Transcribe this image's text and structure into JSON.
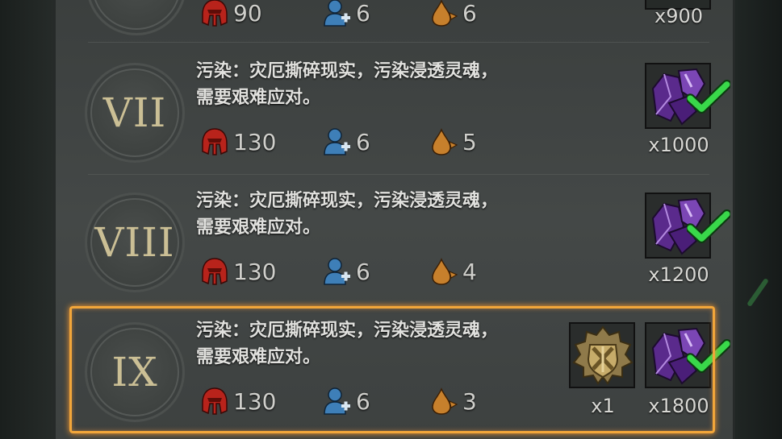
{
  "colors": {
    "highlight": "#f2a63a",
    "numeral": "#cbbf95",
    "helmet": "#b8231b",
    "player": "#3e7fb8",
    "drop": "#c7802c",
    "check": "#39d84a"
  },
  "top_row": {
    "attack": "90",
    "players": "6",
    "drops": "6",
    "reward_qty": "x900"
  },
  "levels": [
    {
      "numeral": "VII",
      "desc_line1": "污染：灾厄撕碎现实，污染浸透灵魂，",
      "desc_line2": "需要艰难应对。",
      "attack": "130",
      "players": "6",
      "drops": "5",
      "rewards": [
        {
          "icon": "purple-crystal-icon",
          "qty": "x1000",
          "claimed": true
        }
      ]
    },
    {
      "numeral": "VIII",
      "desc_line1": "污染：灾厄撕碎现实，污染浸透灵魂，",
      "desc_line2": "需要艰难应对。",
      "attack": "130",
      "players": "6",
      "drops": "4",
      "rewards": [
        {
          "icon": "purple-crystal-icon",
          "qty": "x1200",
          "claimed": true
        }
      ]
    },
    {
      "numeral": "IX",
      "desc_line1": "污染：灾厄撕碎现实，污染浸透灵魂，",
      "desc_line2": "需要艰难应对。",
      "attack": "130",
      "players": "6",
      "drops": "3",
      "rewards": [
        {
          "icon": "golden-badge-icon",
          "qty": "x1",
          "claimed": false
        },
        {
          "icon": "purple-crystal-icon",
          "qty": "x1800",
          "claimed": true
        }
      ]
    }
  ]
}
